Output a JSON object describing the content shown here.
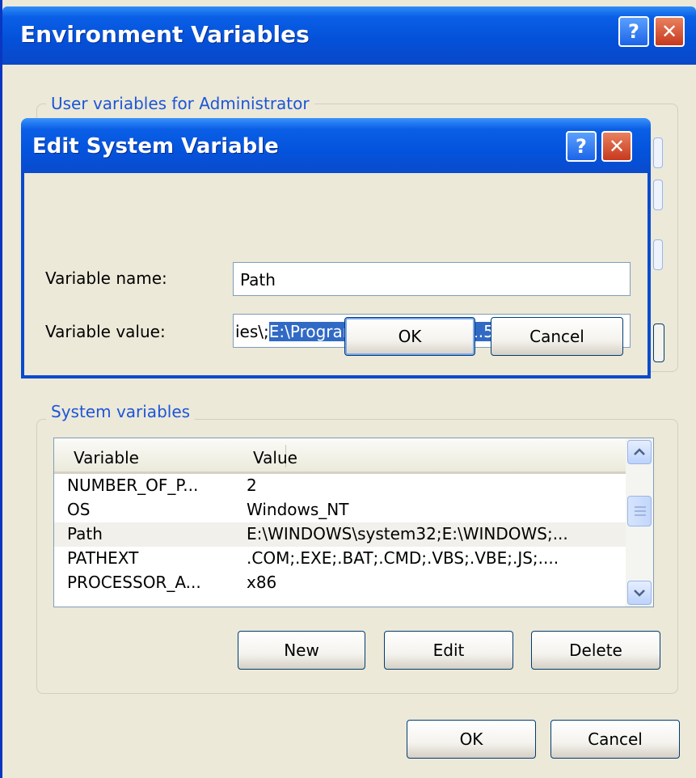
{
  "env_window": {
    "title": "Environment Variables",
    "help_label": "?",
    "close_label": "✕",
    "user_group_label": "User variables for Administrator",
    "system_group_label": "System variables",
    "columns": [
      "Variable",
      "Value"
    ],
    "system_rows": [
      {
        "name": "NUMBER_OF_P...",
        "value": "2"
      },
      {
        "name": "OS",
        "value": "Windows_NT"
      },
      {
        "name": "Path",
        "value": "E:\\WINDOWS\\system32;E:\\WINDOWS;..."
      },
      {
        "name": "PATHEXT",
        "value": ".COM;.EXE;.BAT;.CMD;.VBS;.VBE;.JS;...."
      },
      {
        "name": "PROCESSOR_A...",
        "value": "x86"
      }
    ],
    "selected_row_index": 2,
    "buttons": {
      "new": "New",
      "edit": "Edit",
      "delete": "Delete",
      "ok": "OK",
      "cancel": "Cancel"
    }
  },
  "edit_dialog": {
    "title": "Edit System Variable",
    "help_label": "?",
    "close_label": "✕",
    "name_label": "Variable name:",
    "name_value": "Path",
    "value_label": "Variable value:",
    "value_prefix": "ies\\;",
    "value_selected": "E:\\Program Files\\Java\\jdk1.5.0_04\\bin",
    "ok_label": "OK",
    "cancel_label": "Cancel"
  },
  "colors": {
    "titlebar_blue": "#0a5fe6",
    "dialog_bg": "#ece9d8",
    "group_label": "#1d55d8",
    "selection": "#316ac5",
    "close_red": "#c7391e"
  }
}
